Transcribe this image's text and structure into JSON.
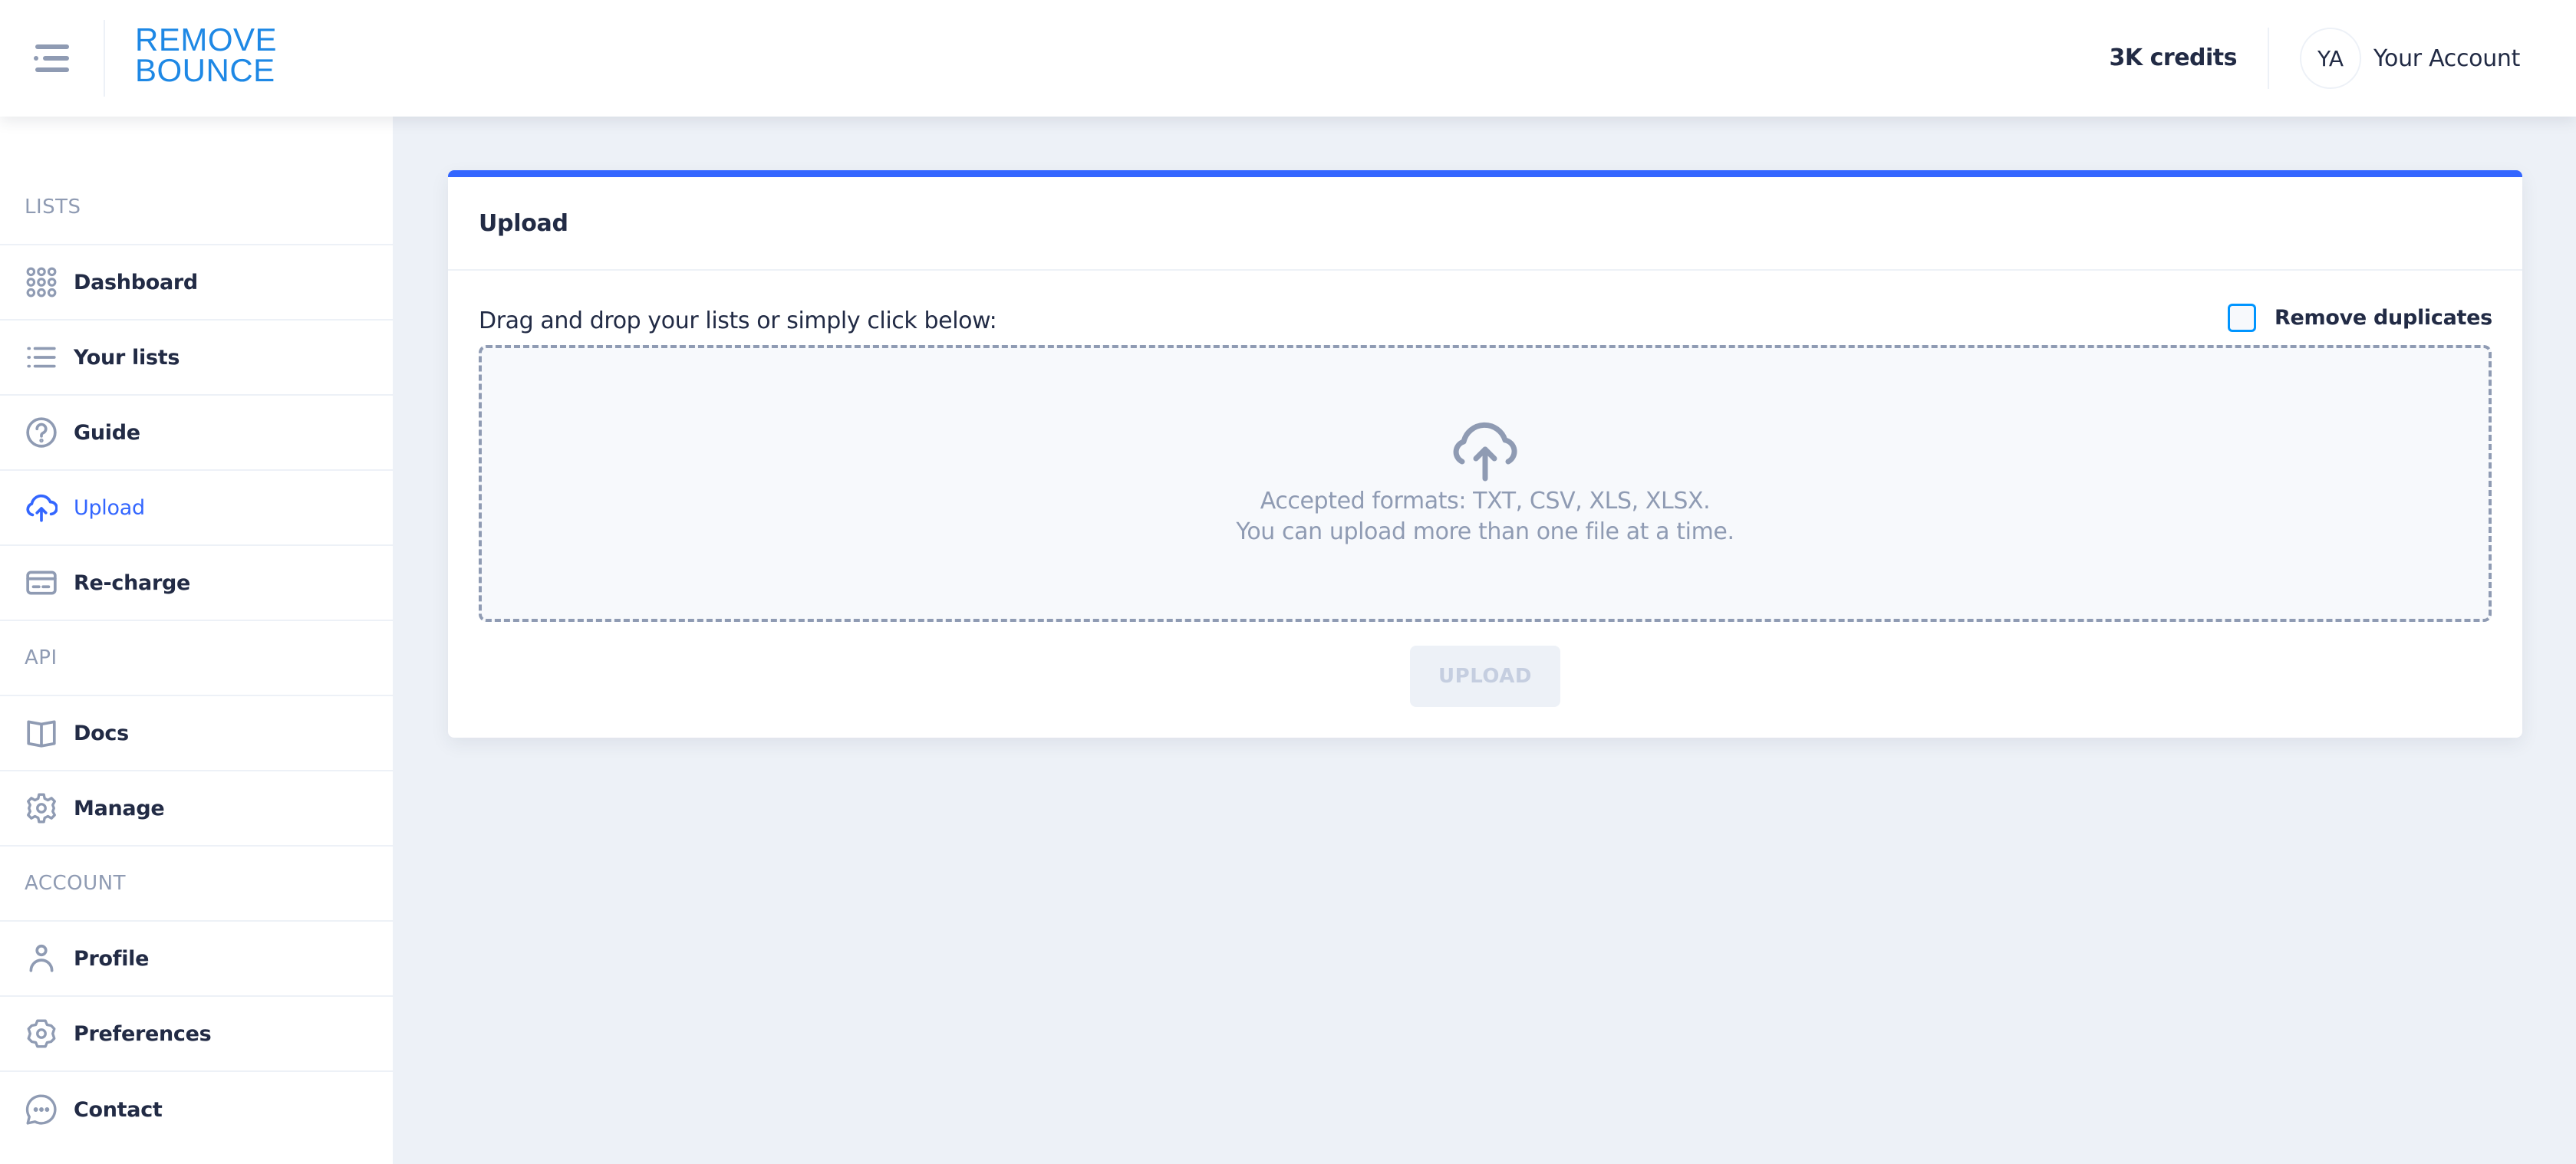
{
  "header": {
    "menu_icon": "menu-list-icon",
    "logo_line1": "REMOVE",
    "logo_line2": "BOUNCE",
    "credits": "3K credits",
    "account": {
      "initials": "YA",
      "name": "Your Account"
    }
  },
  "sidebar": {
    "groups": [
      {
        "label": "LISTS",
        "items": [
          {
            "label": "Dashboard",
            "icon": "grid-icon",
            "active": false
          },
          {
            "label": "Your lists",
            "icon": "list-icon",
            "active": false
          },
          {
            "label": "Guide",
            "icon": "question-circle-icon",
            "active": false
          },
          {
            "label": "Upload",
            "icon": "cloud-upload-icon",
            "active": true
          },
          {
            "label": "Re-charge",
            "icon": "credit-card-icon",
            "active": false
          }
        ]
      },
      {
        "label": "API",
        "items": [
          {
            "label": "Docs",
            "icon": "book-open-icon",
            "active": false
          },
          {
            "label": "Manage",
            "icon": "gear-icon",
            "active": false
          }
        ]
      },
      {
        "label": "ACCOUNT",
        "items": [
          {
            "label": "Profile",
            "icon": "person-icon",
            "active": false
          },
          {
            "label": "Preferences",
            "icon": "settings-icon",
            "active": false
          },
          {
            "label": "Contact",
            "icon": "message-circle-icon",
            "active": false
          }
        ]
      }
    ]
  },
  "upload_card": {
    "title": "Upload",
    "instructions": "Drag and drop your lists or simply click below:",
    "remove_duplicates": {
      "label": "Remove duplicates",
      "checked": false
    },
    "dropzone": {
      "icon": "cloud-upload-icon",
      "line1": "Accepted formats: TXT, CSV, XLS, XLSX.",
      "line2": "You can upload more than one file at a time."
    },
    "upload_button": {
      "label": "UPLOAD",
      "disabled": true
    }
  },
  "colors": {
    "brand": "#1e88e5",
    "primary": "#3366ff",
    "checkbox_border": "#0095ff",
    "text": "#222b45",
    "muted": "#8f9bb3",
    "background": "#edf1f7"
  }
}
